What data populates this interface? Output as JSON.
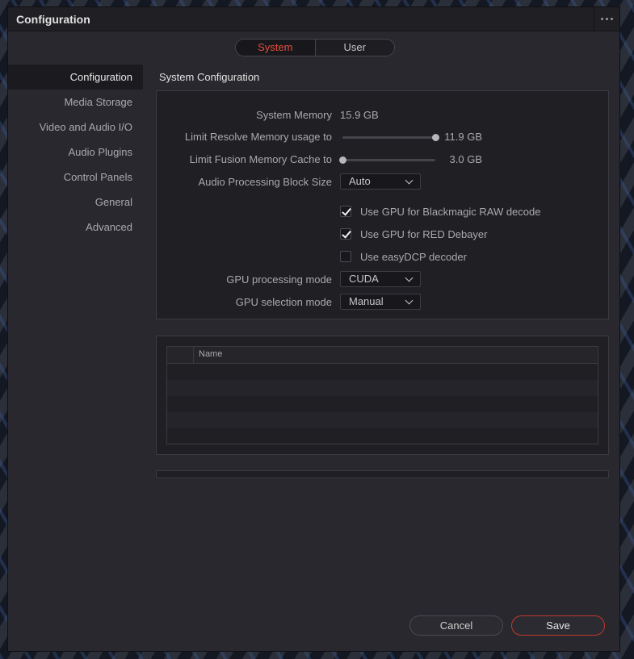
{
  "window": {
    "title": "Configuration"
  },
  "tabs": [
    {
      "label": "System",
      "active": true
    },
    {
      "label": "User",
      "active": false
    }
  ],
  "sidebar": {
    "items": [
      {
        "label": "Configuration",
        "active": true
      },
      {
        "label": "Media Storage"
      },
      {
        "label": "Video and Audio I/O"
      },
      {
        "label": "Audio Plugins"
      },
      {
        "label": "Control Panels"
      },
      {
        "label": "General"
      },
      {
        "label": "Advanced"
      }
    ]
  },
  "main": {
    "section_title": "System Configuration",
    "system_memory": {
      "label": "System Memory",
      "value": "15.9 GB"
    },
    "resolve_memory": {
      "label": "Limit Resolve Memory usage to",
      "value": "11.9 GB",
      "level": 1.0
    },
    "fusion_cache": {
      "label": "Limit Fusion Memory Cache to",
      "value": "3.0 GB",
      "level": 0.0
    },
    "audio_block": {
      "label": "Audio Processing Block Size",
      "selected": "Auto"
    },
    "checkboxes": [
      {
        "label": "Use GPU for Blackmagic RAW decode",
        "checked": true
      },
      {
        "label": "Use GPU for RED Debayer",
        "checked": true
      },
      {
        "label": "Use easyDCP decoder",
        "checked": false
      }
    ],
    "gpu_processing": {
      "label": "GPU processing mode",
      "selected": "CUDA"
    },
    "gpu_selection": {
      "label": "GPU selection mode",
      "selected": "Manual"
    },
    "gpu_table": {
      "columns": [
        "",
        "Name"
      ],
      "rows": []
    }
  },
  "footer": {
    "cancel_label": "Cancel",
    "save_label": "Save"
  },
  "colors": {
    "accent": "#e34c3b",
    "save_border": "#c0392b",
    "panel_bg": "#1f1f24",
    "window_bg": "#28282e"
  }
}
